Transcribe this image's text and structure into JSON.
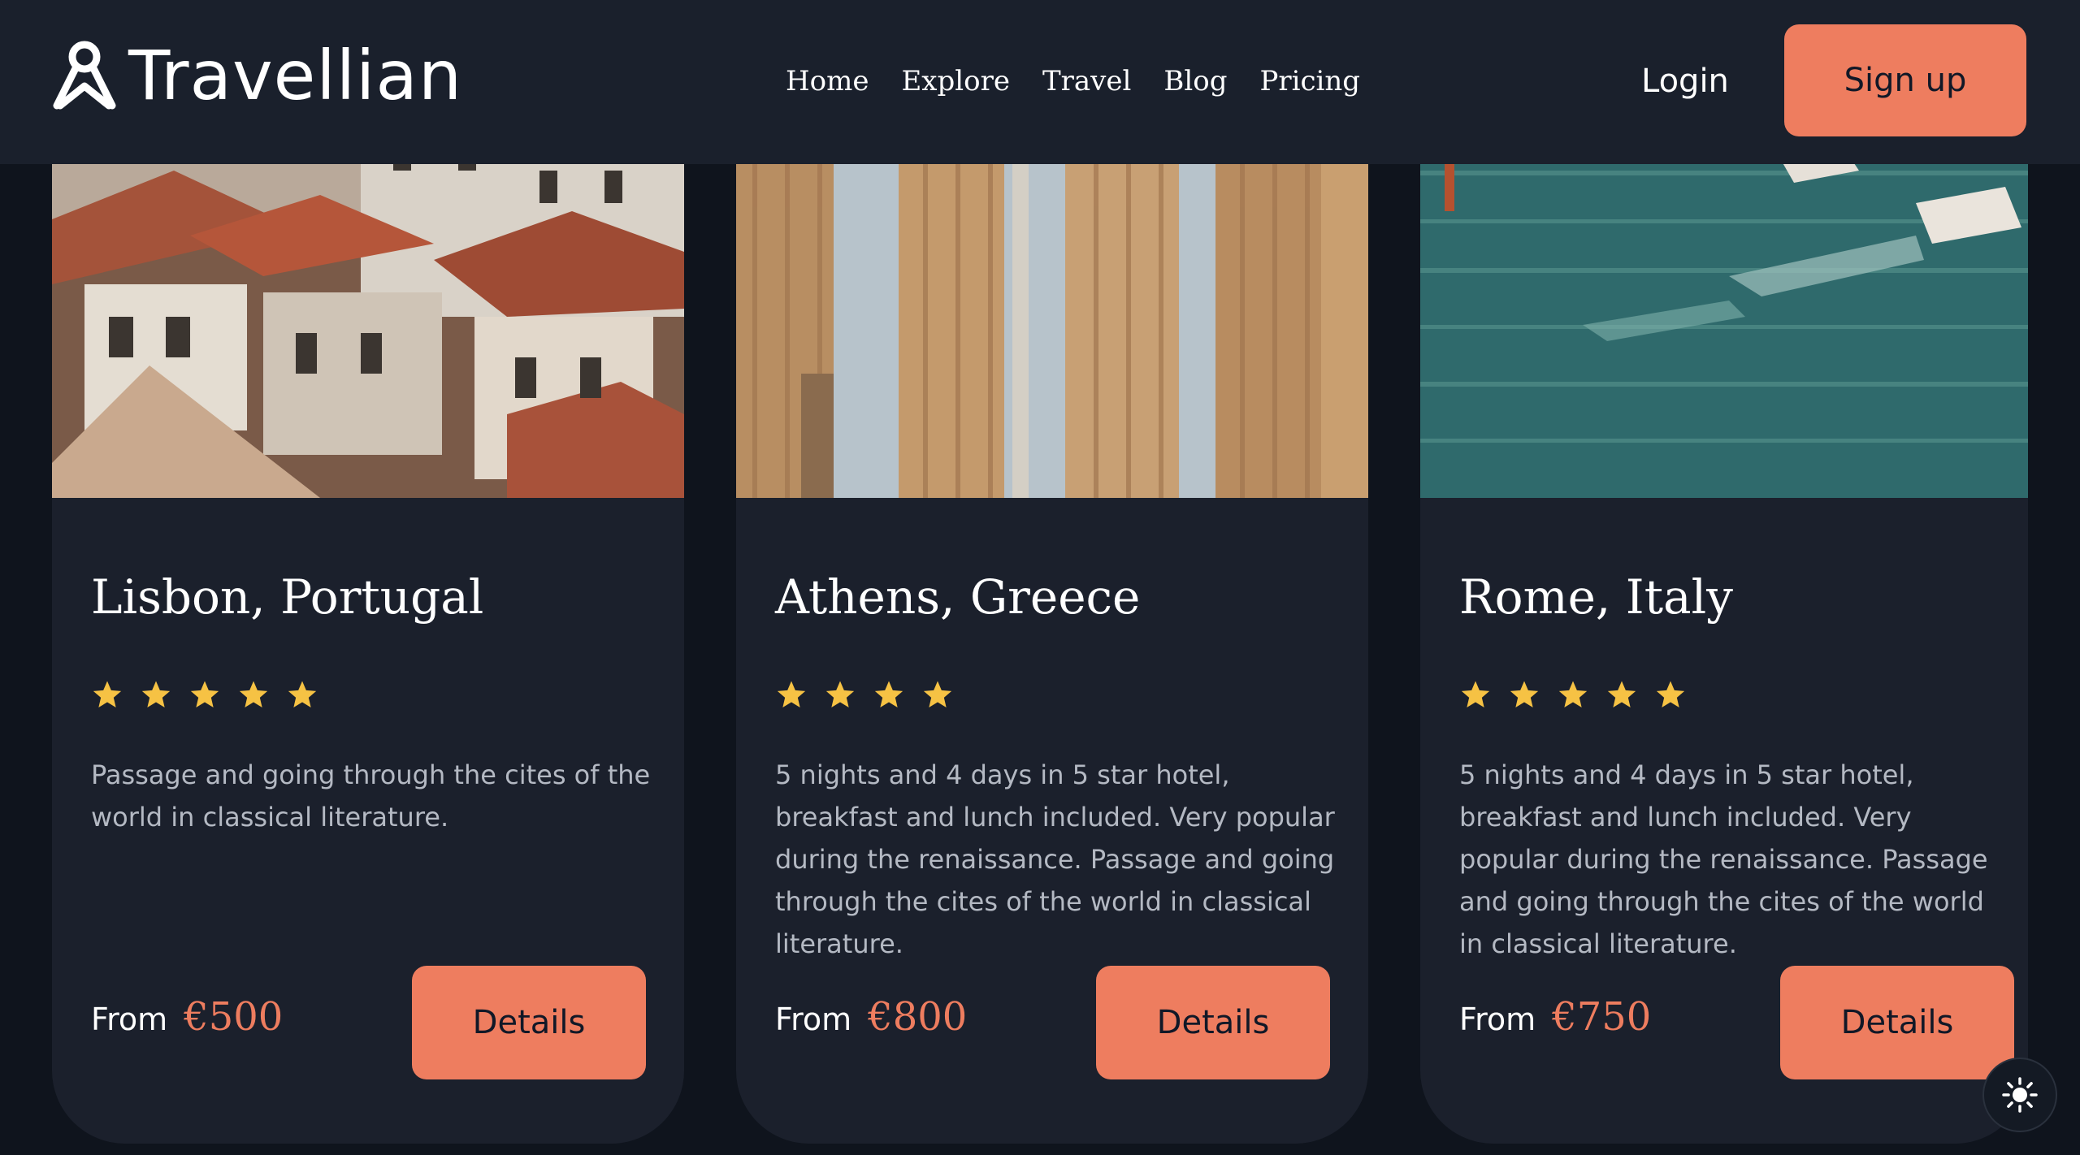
{
  "header": {
    "logo_text": "Travellian",
    "nav": [
      "Home",
      "Explore",
      "Travel",
      "Blog",
      "Pricing"
    ],
    "login_label": "Login",
    "signup_label": "Sign up"
  },
  "cards": [
    {
      "title": "Lisbon, Portugal",
      "rating": 5,
      "description": "Passage and going through the cites of the world in classical literature.",
      "from_label": "From",
      "price": "€500",
      "button_label": "Details",
      "image_icon": "lisbon-rooftops-photo"
    },
    {
      "title": "Athens, Greece",
      "rating": 4,
      "description": "5 nights and 4 days in 5 star hotel, breakfast and lunch included. Very popular during the renaissance. Passage and going through the cites of the world in classical literature.",
      "from_label": "From",
      "price": "€800",
      "button_label": "Details",
      "image_icon": "greek-columns-photo"
    },
    {
      "title": "Rome, Italy",
      "rating": 5,
      "description": "5 nights and 4 days in 5 star hotel, breakfast and lunch included. Very popular during the renaissance. Passage and going through the cites of the world in classical literature.",
      "from_label": "From",
      "price": "€750",
      "button_label": "Details",
      "image_icon": "boats-on-water-photo"
    }
  ],
  "theme_toggle_icon": "sun-icon",
  "colors": {
    "accent": "#ee7d5f",
    "star": "#f6c244",
    "background": "#0f141d",
    "card": "#1b202c"
  }
}
